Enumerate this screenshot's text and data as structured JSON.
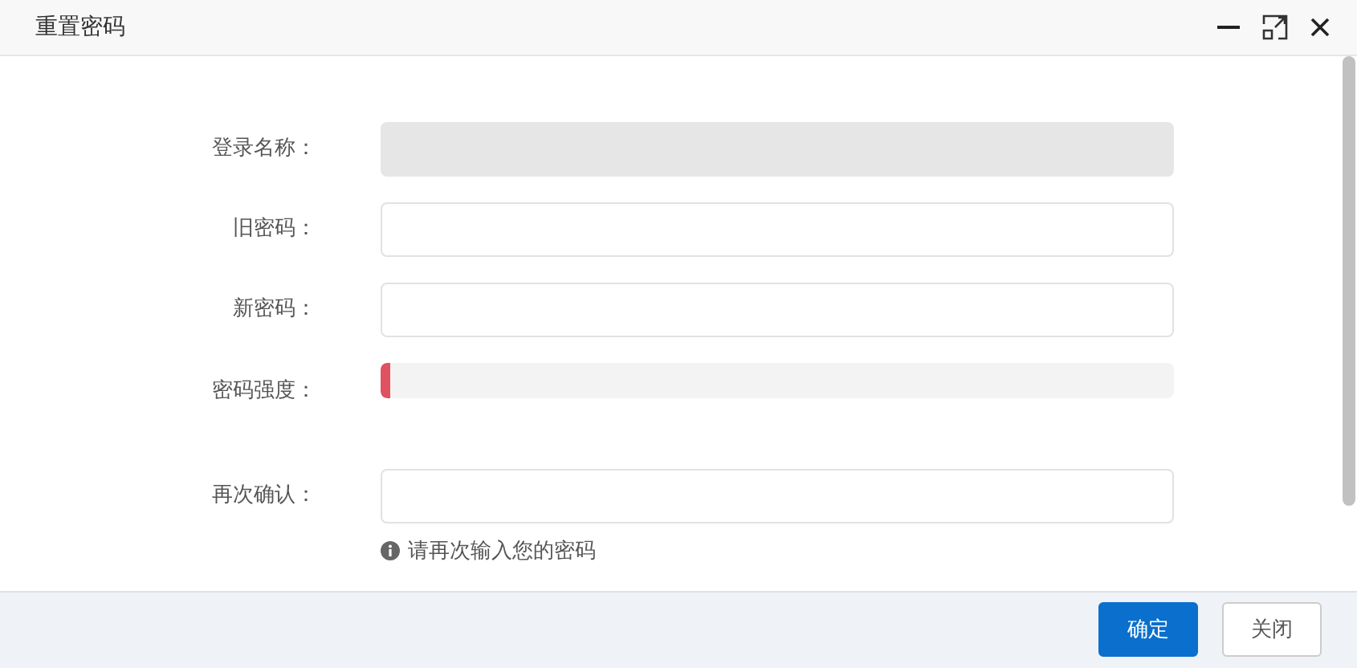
{
  "window": {
    "title": "重置密码"
  },
  "form": {
    "fields": [
      {
        "kind": "input",
        "label": "登录名称：",
        "disabled": true
      },
      {
        "kind": "input",
        "label": "旧密码：",
        "disabled": false
      },
      {
        "kind": "input",
        "label": "新密码：",
        "disabled": false
      },
      {
        "kind": "strength",
        "label": "密码强度：",
        "level": 0.012,
        "color": "#e05260"
      },
      {
        "kind": "input",
        "label": "再次确认：",
        "disabled": false,
        "hint": "请再次输入您的密码"
      }
    ]
  },
  "buttons": [
    {
      "label": "确定",
      "primary": true
    },
    {
      "label": "关闭",
      "primary": false
    }
  ]
}
